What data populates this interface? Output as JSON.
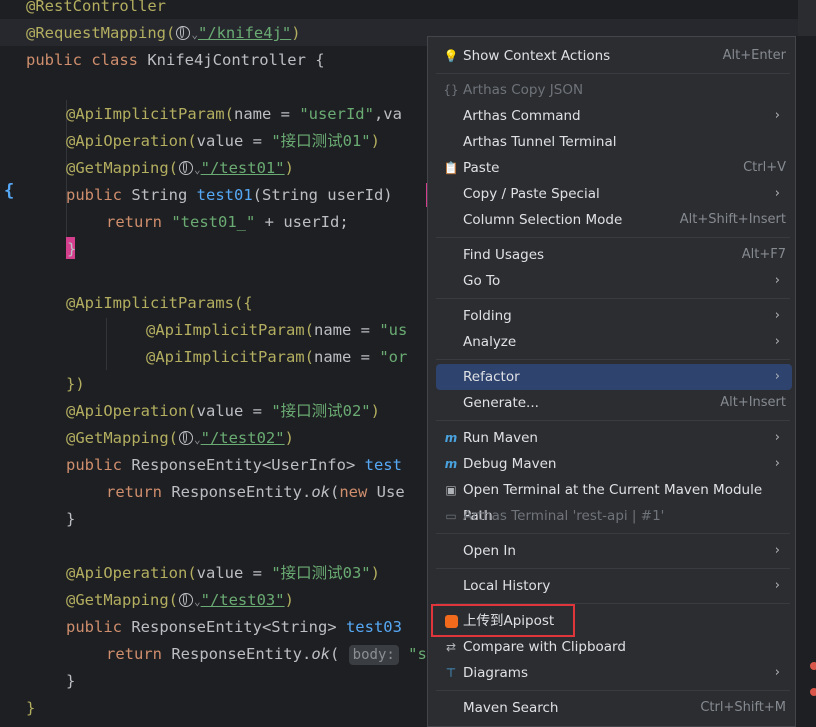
{
  "code": {
    "line0_ann": "@RestController",
    "line1_ann": "@RequestMapping(",
    "line1_url": "\"/knife4j\"",
    "line1_close": ")",
    "line2_kw": "public class ",
    "line2_name": "Knife4jController {",
    "line4_ann": "@ApiImplicitParam(",
    "line4_rest": "name = ",
    "line4_str": "\"userId\"",
    "line4_tail": ",va",
    "line5_ann": "@ApiOperation(",
    "line5_rest": "value = ",
    "line5_str": "\"接口测试01\"",
    "line5_close": ")",
    "line6_ann": "@GetMapping(",
    "line6_url": "\"/test01\"",
    "line6_close": ")",
    "line7_kw": "public ",
    "line7_type": "String ",
    "line7_fn": "test01",
    "line7_rest": "(String userId)",
    "line8_kw": "return ",
    "line8_str": "\"test01_\"",
    "line8_rest": " + userId;",
    "line9": "}",
    "line11_ann": "@ApiImplicitParams({",
    "line12_ann": "@ApiImplicitParam(",
    "line12_rest": "name = ",
    "line12_str": "\"us",
    "line13_ann": "@ApiImplicitParam(",
    "line13_rest": "name = ",
    "line13_str": "\"or",
    "line14": "})",
    "line15_ann": "@ApiOperation(",
    "line15_rest": "value = ",
    "line15_str": "\"接口测试02\"",
    "line15_close": ")",
    "line16_ann": "@GetMapping(",
    "line16_url": "\"/test02\"",
    "line16_close": ")",
    "line17_kw": "public ",
    "line17_rest": "ResponseEntity<UserInfo> ",
    "line17_fn": "test",
    "line18_kw": "return ",
    "line18_rest": "ResponseEntity.",
    "line18_ital": "ok",
    "line18_tail": "(",
    "line18_new": "new ",
    "line18_use": "Use",
    "line19": "}",
    "line21_ann": "@ApiOperation(",
    "line21_rest": "value = ",
    "line21_str": "\"接口测试03\"",
    "line21_close": ")",
    "line22_ann": "@GetMapping(",
    "line22_url": "\"/test03\"",
    "line22_close": ")",
    "line23_kw": "public ",
    "line23_rest": "ResponseEntity<String> ",
    "line23_fn": "test03",
    "line24_kw": "return ",
    "line24_rest": "ResponseEntity.",
    "line24_ital": "ok",
    "line24_tail": "( ",
    "line24_hint": "body:",
    "line24_str": " \"s",
    "line25": "}",
    "line26": "}",
    "brace_left": "{"
  },
  "menu": {
    "show_context_actions": "Show Context Actions",
    "show_context_actions_sc": "Alt+Enter",
    "arthas_copy_json": "Arthas Copy JSON",
    "arthas_command": "Arthas Command",
    "arthas_tunnel": "Arthas Tunnel Terminal",
    "paste": "Paste",
    "paste_sc": "Ctrl+V",
    "copy_paste_special": "Copy / Paste Special",
    "column_selection": "Column Selection Mode",
    "column_selection_sc": "Alt+Shift+Insert",
    "find_usages": "Find Usages",
    "find_usages_sc": "Alt+F7",
    "go_to": "Go To",
    "folding": "Folding",
    "analyze": "Analyze",
    "refactor": "Refactor",
    "generate": "Generate...",
    "generate_sc": "Alt+Insert",
    "run_maven": "Run Maven",
    "debug_maven": "Debug Maven",
    "open_terminal_maven": "Open Terminal at the Current Maven Module Path",
    "arthas_terminal": "Arthas Terminal 'rest-api | #1'",
    "open_in": "Open In",
    "local_history": "Local History",
    "upload_apipost": "上传到Apipost",
    "compare_clipboard": "Compare with Clipboard",
    "diagrams": "Diagrams",
    "maven_search": "Maven Search",
    "maven_search_sc": "Ctrl+Shift+M"
  },
  "icons": {
    "bulb": "lightbulb-icon",
    "json": "json-braces-icon",
    "paste": "clipboard-icon",
    "maven": "maven-icon",
    "apipost": "apipost-icon",
    "compare": "compare-icon",
    "diagram": "diagram-icon"
  },
  "colors": {
    "selected": "#2e436e",
    "highlight_box": "#e0353b",
    "apipost": "#f26b1d"
  }
}
